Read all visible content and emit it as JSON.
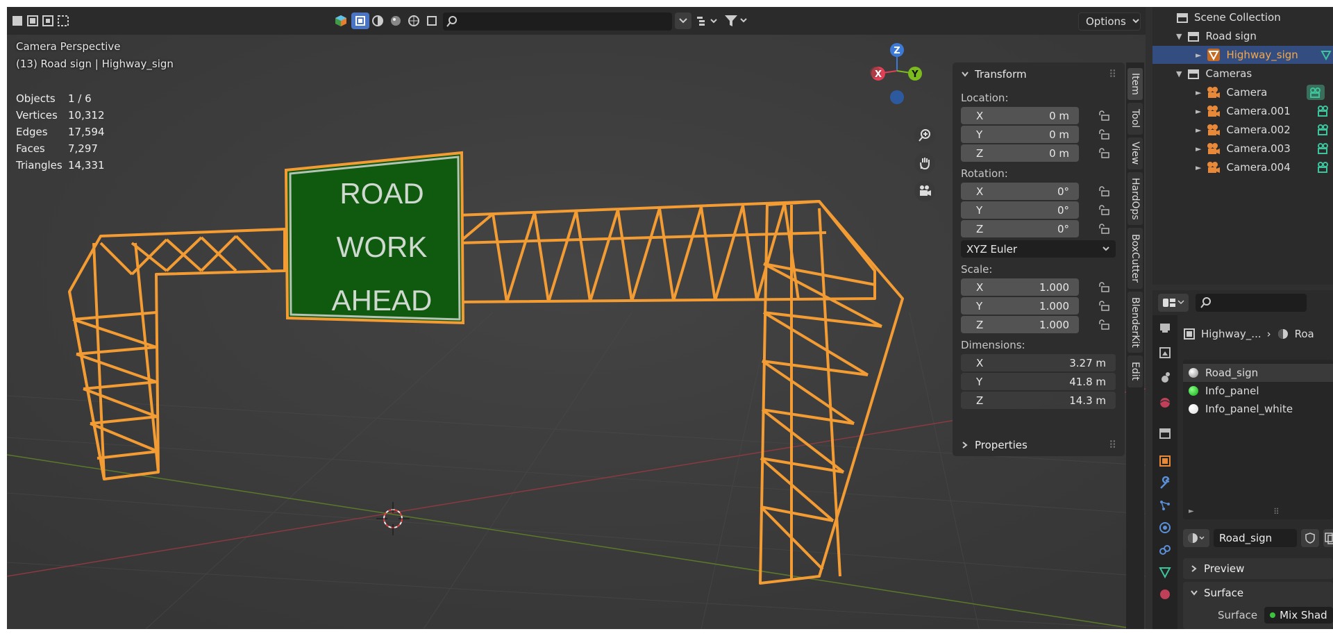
{
  "viewport": {
    "title": "Camera Perspective",
    "subtitle": "(13) Road sign | Highway_sign",
    "stats": [
      {
        "key": "Objects",
        "value": "1 / 6"
      },
      {
        "key": "Vertices",
        "value": "10,312"
      },
      {
        "key": "Edges",
        "value": "17,594"
      },
      {
        "key": "Faces",
        "value": "7,297"
      },
      {
        "key": "Triangles",
        "value": "14,331"
      }
    ],
    "sign_lines": [
      "ROAD",
      "WORK",
      "AHEAD"
    ],
    "options_label": "Options",
    "axes": {
      "x": "X",
      "y": "Y",
      "z": "Z"
    }
  },
  "colors": {
    "accent": "#f39c34",
    "sign_green": "#0f5a0f",
    "selection": "#334d80",
    "axis_x": "#e04055",
    "axis_y": "#7cbb1d",
    "axis_z": "#3d7ad8"
  },
  "npanel": {
    "transform_label": "Transform",
    "location_label": "Location:",
    "location": [
      {
        "axis": "X",
        "value": "0 m"
      },
      {
        "axis": "Y",
        "value": "0 m"
      },
      {
        "axis": "Z",
        "value": "0 m"
      }
    ],
    "rotation_label": "Rotation:",
    "rotation": [
      {
        "axis": "X",
        "value": "0°"
      },
      {
        "axis": "Y",
        "value": "0°"
      },
      {
        "axis": "Z",
        "value": "0°"
      }
    ],
    "rotation_mode": "XYZ Euler",
    "scale_label": "Scale:",
    "scale": [
      {
        "axis": "X",
        "value": "1.000"
      },
      {
        "axis": "Y",
        "value": "1.000"
      },
      {
        "axis": "Z",
        "value": "1.000"
      }
    ],
    "dimensions_label": "Dimensions:",
    "dimensions": [
      {
        "axis": "X",
        "value": "3.27 m"
      },
      {
        "axis": "Y",
        "value": "41.8 m"
      },
      {
        "axis": "Z",
        "value": "14.3 m"
      }
    ],
    "properties_label": "Properties"
  },
  "vtabs": [
    "Item",
    "Tool",
    "View",
    "HardOps",
    "BoxCutter",
    "BlenderKit",
    "Edit"
  ],
  "outliner": {
    "root": "Scene Collection",
    "items": [
      {
        "label": "Road sign"
      },
      {
        "label": "Highway_sign"
      },
      {
        "label": "Cameras"
      },
      {
        "label": "Camera"
      },
      {
        "label": "Camera.001"
      },
      {
        "label": "Camera.002"
      },
      {
        "label": "Camera.003"
      },
      {
        "label": "Camera.004"
      }
    ]
  },
  "properties": {
    "breadcrumb_object": "Highway_...",
    "breadcrumb_material": "Roa",
    "materials": [
      {
        "name": "Road_sign",
        "color": "#cccccc"
      },
      {
        "name": "Info_panel",
        "color": "#22bb22"
      },
      {
        "name": "Info_panel_white",
        "color": "#ffffff"
      }
    ],
    "material_name": "Road_sign",
    "preview_label": "Preview",
    "surface_label": "Surface",
    "surface_field_label": "Surface",
    "surface_value": "Mix Shad"
  }
}
